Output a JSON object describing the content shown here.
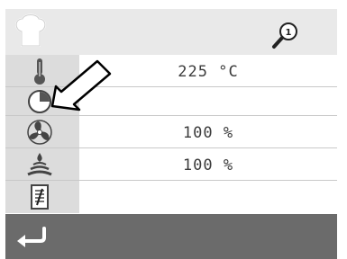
{
  "topbar": {
    "chef_icon": "chef-hat-icon",
    "search_icon": "magnifier-one-icon",
    "search_badge": "1"
  },
  "rows": [
    {
      "icon": "thermometer-icon",
      "value": "225  °C"
    },
    {
      "icon": "clock-icon",
      "value": ""
    },
    {
      "icon": "fan-icon",
      "value": "100  %"
    },
    {
      "icon": "humidity-icon",
      "value": "100  %"
    },
    {
      "icon": "notes-icon",
      "value": ""
    }
  ],
  "bottombar": {
    "back_icon": "back-arrow-icon"
  },
  "annotation": {
    "icon": "pointer-arrow-icon"
  },
  "colors": {
    "panel": "#e9e9e9",
    "icon_column": "#dcdcdc",
    "bottom_bar": "#6b6b6b",
    "text": "#3c3c3c"
  }
}
